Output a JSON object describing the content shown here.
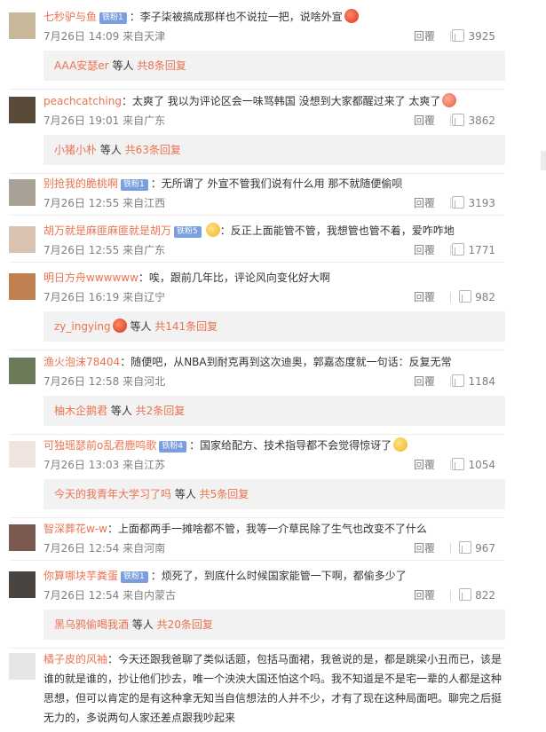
{
  "comments": [
    {
      "nick": "七秒驴与鱼",
      "badge": "铁粉1",
      "text": "：李子柒被搞成那样也不说拉一把，说啥外宣",
      "emoji": "red",
      "date": "7月26日 14:09 来自天津",
      "reply": "回覆",
      "likes": "3925",
      "sub": {
        "nick": "AAA安瑟er",
        "mid": " 等人 ",
        "count": "共8条回复"
      }
    },
    {
      "nick": "peachcatching",
      "badge": "",
      "text": "：太爽了 我以为评论区会一味骂韩国 没想到大家都醒过来了 太爽了",
      "emoji": "heart",
      "date": "7月26日 19:01 来自广东",
      "reply": "回覆",
      "likes": "3862",
      "sub": {
        "nick": "小猪小朴",
        "mid": " 等人 ",
        "count": "共63条回复"
      }
    },
    {
      "nick": "别抢我的脆桃啊",
      "badge": "铁粉1",
      "text": "：无所谓了 外宣不管我们说有什么用 那不就随便偷呗",
      "emoji": "",
      "date": "7月26日 12:55 来自江西",
      "reply": "回覆",
      "likes": "3193",
      "sub": null
    },
    {
      "nick": "胡万就是麻匪麻匪就是胡万",
      "badge": "铁粉5",
      "text": "：反正上面能管不管，我想管也管不着，爱咋咋地",
      "emoji": "yel",
      "emojiBefore": true,
      "date": "7月26日 12:55 来自广东",
      "reply": "回覆",
      "likes": "1771",
      "sub": null
    },
    {
      "nick": "明日方舟wwwwww",
      "badge": "",
      "text": "：唉，跟前几年比，评论风向变化好大啊",
      "emoji": "",
      "date": "7月26日 16:19 来自辽宁",
      "reply": "回覆",
      "likes": "982",
      "sub": {
        "nick": "zy_ingying",
        "mid": " 等人 ",
        "count": "共141条回复",
        "emo": true
      }
    },
    {
      "nick": "渔火泡沫78404",
      "badge": "",
      "text": "：随便吧，从NBA到耐克再到这次迪奥，郭嘉态度就一句话：反复无常",
      "emoji": "",
      "date": "7月26日 12:58 来自河北",
      "reply": "回覆",
      "likes": "1184",
      "sub": {
        "nick": "柚木企鹅君",
        "mid": " 等人 ",
        "count": "共2条回复"
      }
    },
    {
      "nick": "可独瑶瑟前o乱君鹿鸣歌",
      "badge": "铁粉4",
      "text": "：国家给配方、技术指导都不会觉得惊讶了",
      "emoji": "yel",
      "date": "7月26日 13:03 来自江苏",
      "reply": "回覆",
      "likes": "1054",
      "sub": {
        "nick": "今天的我青年大学习了吗",
        "mid": " 等人 ",
        "count": "共5条回复"
      }
    },
    {
      "nick": "智深葬花w-w",
      "badge": "",
      "text": "：上面都两手一摊啥都不管，我等一介草民除了生气也改变不了什么",
      "emoji": "",
      "date": "7月26日 12:54 来自河南",
      "reply": "回覆",
      "likes": "967",
      "sub": null
    },
    {
      "nick": "你算哪块芋粪蛋",
      "badge": "铁粉1",
      "text": "：烦死了，到底什么时候国家能管一下啊，都偷多少了",
      "emoji": "",
      "date": "7月26日 12:54 来自内蒙古",
      "reply": "回覆",
      "likes": "822",
      "sub": {
        "nick": "黑乌鸦偷喝我酒",
        "mid": " 等人 ",
        "count": "共20条回复"
      }
    }
  ],
  "last": {
    "nick": "橘子皮的风袖",
    "text": "：今天还跟我爸聊了类似话题，包括马面裙，我爸说的是，都是跳梁小丑而已，该是谁的就是谁的，抄让他们抄去，唯一个泱泱大国还怕这个吗。我不知道是不是宅一辈的人都是这种思想，但可以肯定的是有这种拿无知当自信想法的人并不少，才有了现在这种局面吧。聊完之后挺无力的，多说两句人家还差点跟我吵起来"
  }
}
